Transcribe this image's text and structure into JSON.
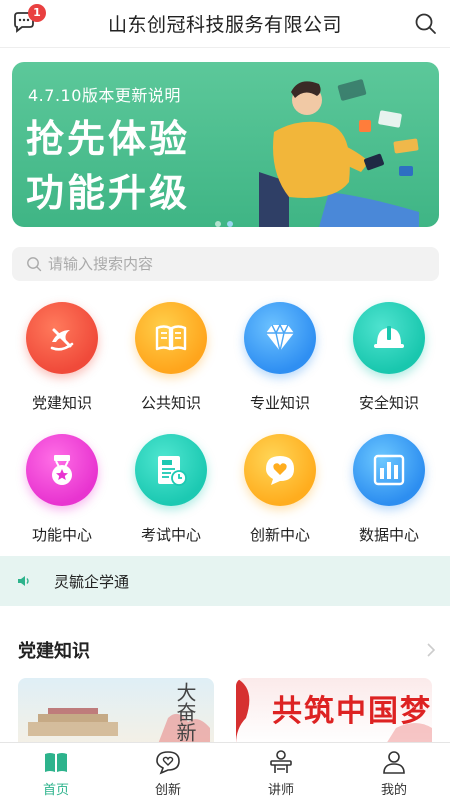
{
  "header": {
    "title": "山东创冠科技服务有限公司",
    "message_badge": "1",
    "message_icon": "chat-bubble-icon",
    "search_icon": "search-icon"
  },
  "banner": {
    "subtitle": "4.7.10版本更新说明",
    "line1": "抢先体验",
    "line2": "功能升级",
    "slide_count": 2,
    "active_slide": 2
  },
  "search": {
    "placeholder": "请输入搜索内容"
  },
  "grid": [
    {
      "label": "党建知识",
      "icon": "party-emblem-icon",
      "color": "#f04a3a"
    },
    {
      "label": "公共知识",
      "icon": "book-icon",
      "color": "#ffa51c"
    },
    {
      "label": "专业知识",
      "icon": "diamond-icon",
      "color": "#2f8ff2"
    },
    {
      "label": "安全知识",
      "icon": "helmet-icon",
      "color": "#19c7ae"
    },
    {
      "label": "功能中心",
      "icon": "medal-icon",
      "color": "#e834d0"
    },
    {
      "label": "考试中心",
      "icon": "exam-sheet-icon",
      "color": "#1cc9b2"
    },
    {
      "label": "创新中心",
      "icon": "heart-chat-icon",
      "color": "#ffad1e"
    },
    {
      "label": "数据中心",
      "icon": "bar-chart-icon",
      "color": "#2d8ef0"
    }
  ],
  "notice": {
    "text": "灵毓企学通",
    "icon": "speaker-icon"
  },
  "section": {
    "title": "党建知识",
    "card1_text": "大奋新",
    "card2_text": "共筑中国梦"
  },
  "bottom_nav": [
    {
      "label": "首页",
      "icon": "book-open-icon",
      "active": true
    },
    {
      "label": "创新",
      "icon": "heart-chat-icon",
      "active": false
    },
    {
      "label": "讲师",
      "icon": "lecturer-icon",
      "active": false
    },
    {
      "label": "我的",
      "icon": "user-icon",
      "active": false
    }
  ],
  "colors": {
    "accent": "#2db38c",
    "banner_green": "#4cbd8c",
    "notice_bg": "#e6f4f1",
    "badge_red": "#e94040"
  }
}
